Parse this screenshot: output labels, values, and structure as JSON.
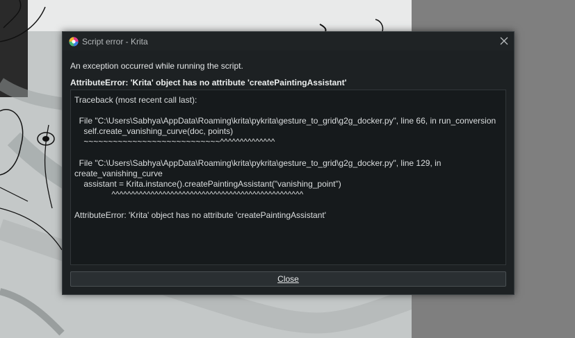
{
  "window": {
    "title": "Script error - Krita"
  },
  "dialog": {
    "message": "An exception occurred while running the script.",
    "error_heading": "AttributeError: 'Krita' object has no attribute 'createPaintingAssistant'",
    "traceback_lines": [
      "Traceback (most recent call last):",
      "  File \"C:\\Users\\Sabhya\\AppData\\Roaming\\krita\\pykrita\\gesture_to_grid\\g2g_docker.py\", line 66, in run_conversion",
      "    self.create_vanishing_curve(doc, points)",
      "    ~~~~~~~~~~~~~~~~~~~~~~~~~~~~^^^^^^^^^^^^^^",
      "  File \"C:\\Users\\Sabhya\\AppData\\Roaming\\krita\\pykrita\\gesture_to_grid\\g2g_docker.py\", line 129, in",
      "create_vanishing_curve",
      "    assistant = Krita.instance().createPaintingAssistant(\"vanishing_point\")",
      "                ^^^^^^^^^^^^^^^^^^^^^^^^^^^^^^^^^^^^^^^^^^^^^^^^^",
      "AttributeError: 'Krita' object has no attribute 'createPaintingAssistant'"
    ],
    "close_label": "Close"
  },
  "colors": {
    "dialog_bg": "#1d2123",
    "trace_bg": "#161a1c",
    "text": "#e3e5e6"
  },
  "icons": {
    "app": "krita-logo-icon",
    "close": "close-icon"
  }
}
